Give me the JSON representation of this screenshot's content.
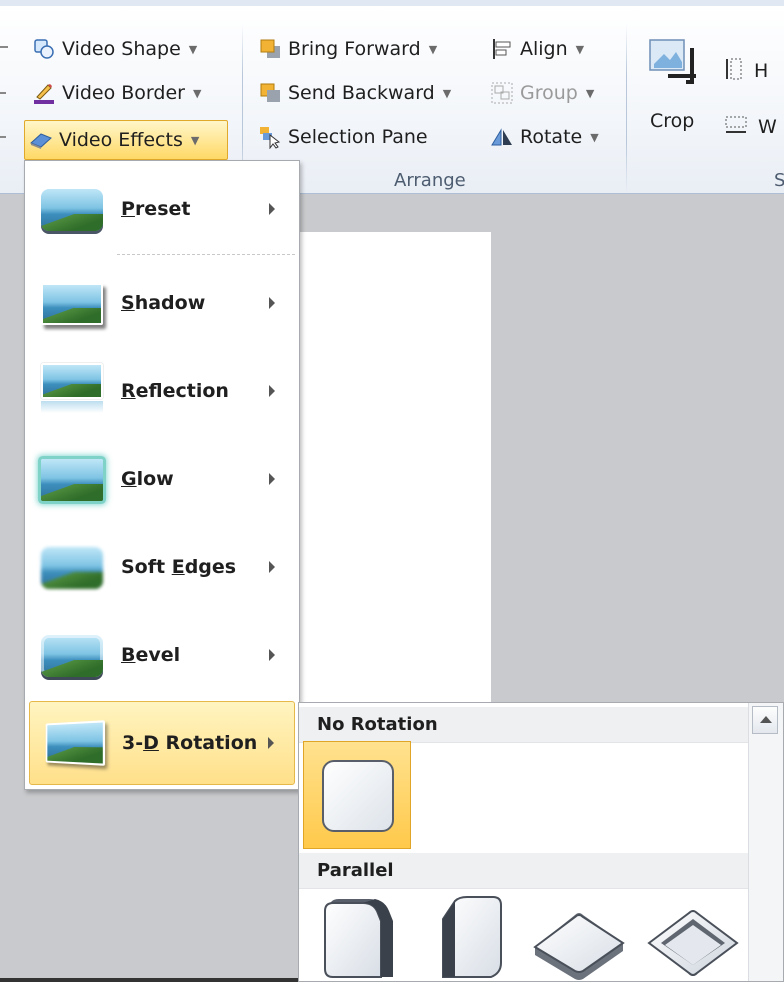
{
  "ribbon": {
    "video_shape": "Video Shape",
    "video_border": "Video Border",
    "video_effects": "Video Effects",
    "bring_forward": "Bring Forward",
    "send_backward": "Send Backward",
    "selection_pane": "Selection Pane",
    "align": "Align",
    "group": "Group",
    "rotate": "Rotate",
    "arrange_label": "Arrange",
    "crop": "Crop",
    "height_partial": "H",
    "width_partial": "W",
    "size_partial": "S"
  },
  "menu": {
    "items": [
      {
        "pre": "",
        "key": "P",
        "post": "reset",
        "icon": "preset-icon"
      },
      {
        "pre": "",
        "key": "S",
        "post": "hadow",
        "icon": "shadow-icon"
      },
      {
        "pre": "",
        "key": "R",
        "post": "eflection",
        "icon": "reflection-icon"
      },
      {
        "pre": "",
        "key": "G",
        "post": "low",
        "icon": "glow-icon"
      },
      {
        "pre": "Soft ",
        "key": "E",
        "post": "dges",
        "icon": "soft-edges-icon"
      },
      {
        "pre": "",
        "key": "B",
        "post": "evel",
        "icon": "bevel-icon"
      },
      {
        "pre": "3-",
        "key": "D",
        "post": " Rotation",
        "icon": "3d-rotation-icon"
      }
    ]
  },
  "gallery": {
    "section1": "No Rotation",
    "section2": "Parallel"
  },
  "colors": {
    "highlight": "#ffd966",
    "ribbon_bg": "#f3f6fa",
    "workspace": "#c8cacd"
  }
}
